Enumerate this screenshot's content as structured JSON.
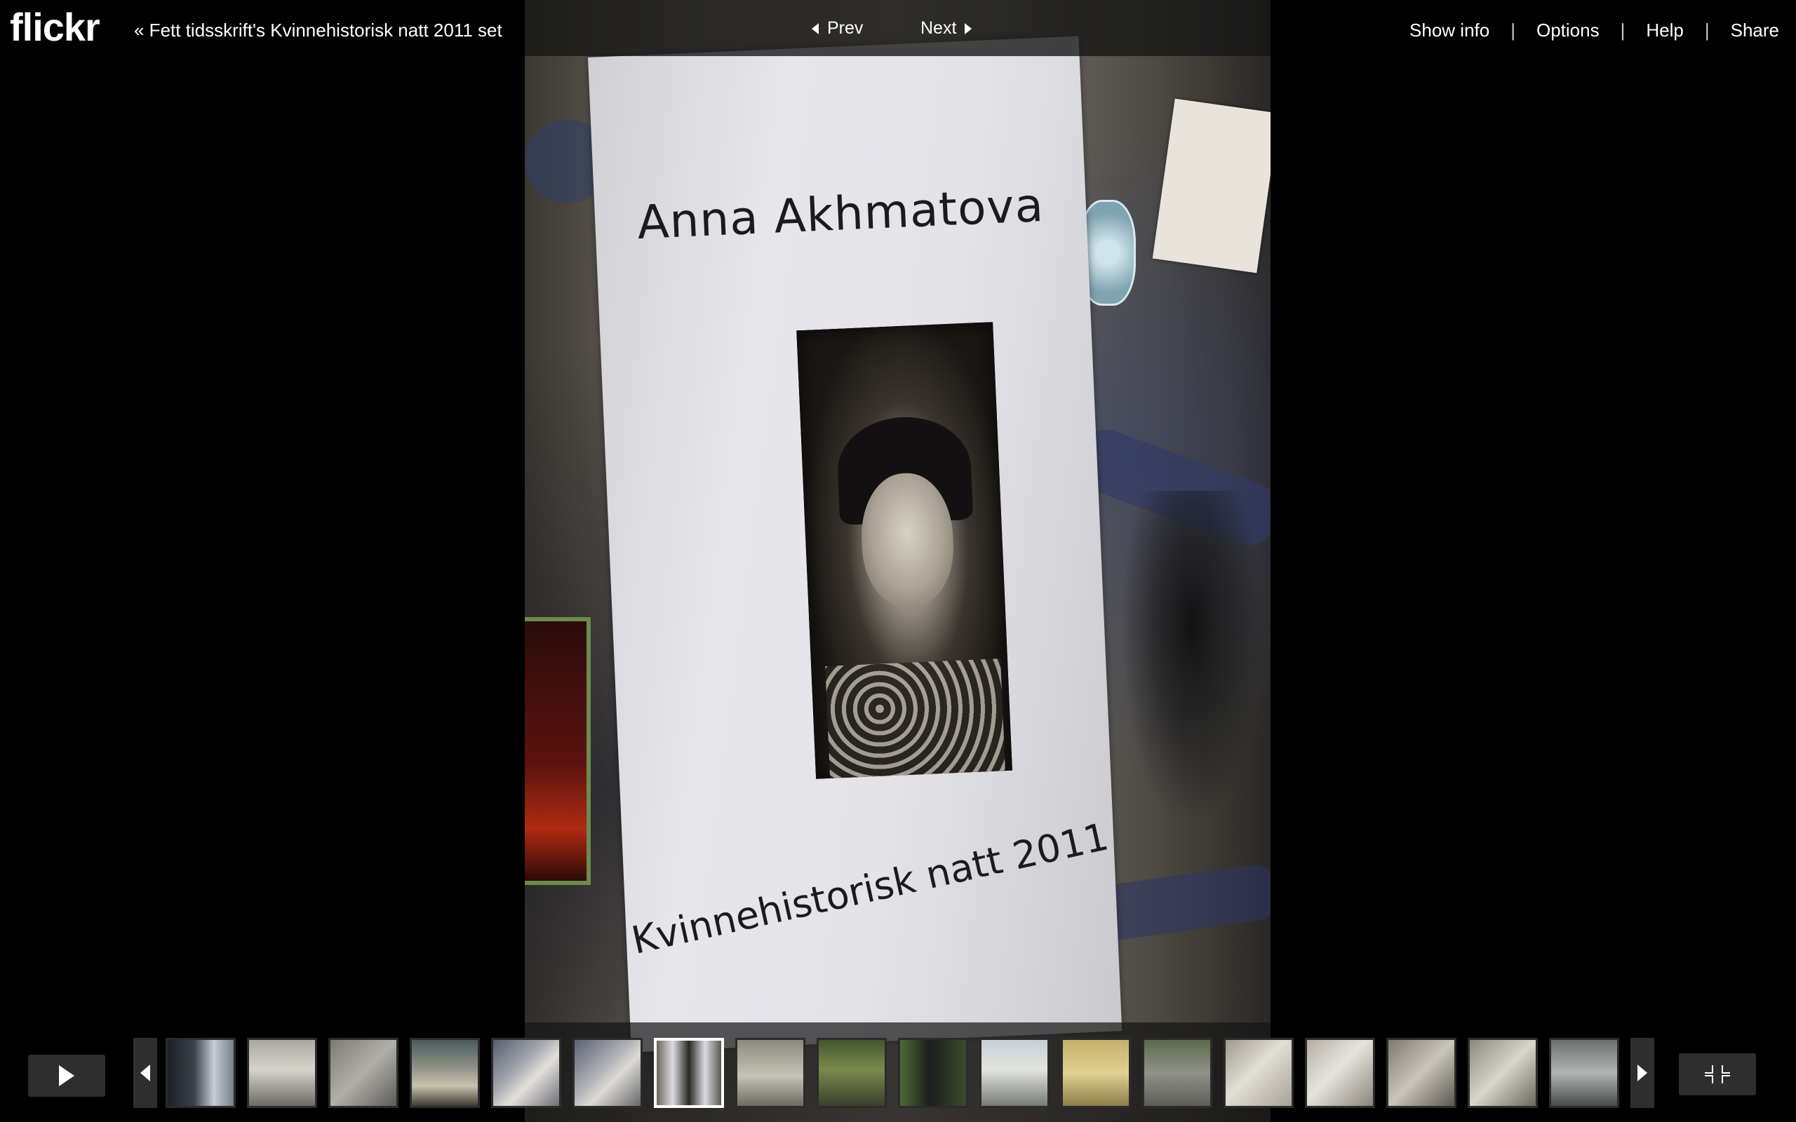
{
  "header": {
    "logo": "flickr",
    "set_link": "« Fett tidsskrift's Kvinnehistorisk natt 2011 set",
    "prev_label": "Prev",
    "next_label": "Next",
    "menu": [
      "Show info",
      "Options",
      "Help",
      "Share"
    ],
    "menu_separator": "|"
  },
  "photo": {
    "poster_title": "Anna Akhmatova",
    "poster_subtitle": "Kvinnehistorisk natt 2011"
  },
  "filmstrip": {
    "active_index": 6,
    "thumbnail_count": 18
  },
  "colors": {
    "background": "#000000",
    "bar_overlay": "#141414",
    "button_bg": "#2e2e2e",
    "text": "#ffffff"
  },
  "icons": {
    "play": "play-icon",
    "fullscreen_exit": "exit-fullscreen-icon",
    "prev": "caret-left-icon",
    "next": "caret-right-icon"
  }
}
